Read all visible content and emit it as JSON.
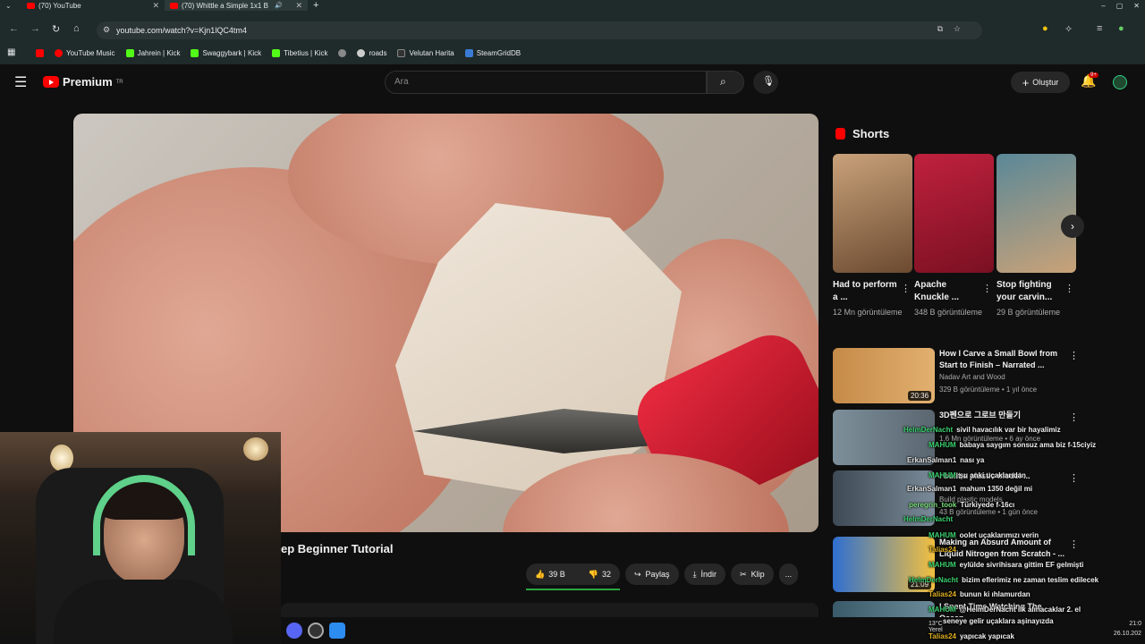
{
  "browser": {
    "tabs": [
      {
        "label": "(70) YouTube"
      },
      {
        "label": "(70) Whittle a Simple 1x1 B"
      }
    ],
    "url": "youtube.com/watch?v=Kjn1lQC4tm4",
    "bookmarks": [
      "YouTube Music",
      "Jahrein | Kick",
      "Swaggybark | Kick",
      "Tibetius | Kick",
      "roads",
      "Velutan Harita",
      "SteamGridDB"
    ]
  },
  "youtube": {
    "logo_text": "Premium",
    "logo_sup": "TR",
    "search_placeholder": "Ara",
    "create_label": "Oluştur",
    "notification_badge": "9+"
  },
  "video": {
    "title_visible": "ep Beginner Tutorial",
    "likes": "39 B",
    "dislikes": "32",
    "share_label": "Paylaş",
    "download_label": "İndir",
    "clip_label": "Klip",
    "more_label": "..."
  },
  "shorts": {
    "heading": "Shorts",
    "items": [
      {
        "title": "Had to perform a ...",
        "views": "12 Mn görüntüleme",
        "color": "#8b6b4a"
      },
      {
        "title": "Apache Knuckle ...",
        "views": "348 B görüntüleme",
        "color": "#a0203a"
      },
      {
        "title": "Stop fighting your carvin...",
        "views": "29 B görüntüleme",
        "color": "#4a6e7a"
      }
    ]
  },
  "recommendations": [
    {
      "title": "How I Carve a Small Bowl from Start to Finish – Narrated ...",
      "channel": "Nadav Art and Wood",
      "meta": "329 B görüntüleme • 1 yıl önce",
      "duration": "20:36",
      "color": "#b07a3a"
    },
    {
      "title": "3D펜으로 그로브 만들기",
      "channel": "",
      "meta": "1,6 Mn görüntüleme • 6 ay önce",
      "duration": "",
      "color": "#6b7d8a"
    },
    {
      "title": "I built a plastic model ...",
      "channel": "Build plastic models",
      "meta": "43 B görüntüleme • 1 gün önce",
      "duration": "",
      "color": "#4a5560"
    },
    {
      "title": "Making an Absurd Amount of Liquid Nitrogen from Scratch - ...",
      "channel": "",
      "meta": "",
      "duration": "21:09",
      "color": "#2a62c4"
    },
    {
      "title": "I Spent Time Watching The Ocean",
      "channel": "",
      "meta": "",
      "duration": "",
      "color": "#3a5a6a"
    }
  ],
  "chat": [
    {
      "user": "HelmDerNacht",
      "msg": "sivil havacılık var bir hayalimiz",
      "color": "#3bd16f"
    },
    {
      "user": "MAHUM",
      "msg": "babaya saygım sonsuz ama biz f-15ciyiz",
      "color": "#3bd16f"
    },
    {
      "user": "ErkanSalman1",
      "msg": "nası ya",
      "color": "#e0e0e0"
    },
    {
      "user": "MAHUM",
      "msg": "şu anki uçaklarıdan",
      "color": "#3bd16f"
    },
    {
      "user": "ErkanSalman1",
      "msg": "mahum 1350 değil mi",
      "color": "#e0e0e0"
    },
    {
      "user": "peregrin_took",
      "msg": "Türkiyede f-16cı",
      "color": "#7be07b"
    },
    {
      "user": "HelmDerNacht",
      "msg": "",
      "color": "#3bd16f"
    },
    {
      "user": "MAHUM",
      "msg": "oolet uçaklarımızı verin",
      "color": "#3bd16f"
    },
    {
      "user": "Talias24",
      "msg": "",
      "color": "#e0b020"
    },
    {
      "user": "MAHUM",
      "msg": "eylülde sivrihisara gittim EF gelmişti",
      "color": "#3bd16f"
    },
    {
      "user": "HelmDerNacht",
      "msg": "bizim eflerimiz ne zaman teslim edilecek",
      "color": "#3bd16f"
    },
    {
      "user": "Talias24",
      "msg": "bunun ki ıhlamurdan",
      "color": "#e0b020"
    },
    {
      "user": "MAHUM",
      "msg": "@HelmDerNacht ilk alınacaklar 2. el",
      "color": "#3bd16f"
    },
    {
      "user": "",
      "msg": "seneye gelir uçaklara aşinayızda",
      "color": "#e0e0e0"
    },
    {
      "user": "Talias24",
      "msg": "yapıcak yapıcak",
      "color": "#e0b020"
    }
  ],
  "taskbar": {
    "temp": "13°C",
    "weather": "Yerel",
    "time": "21:0",
    "date": "26.10.202"
  }
}
